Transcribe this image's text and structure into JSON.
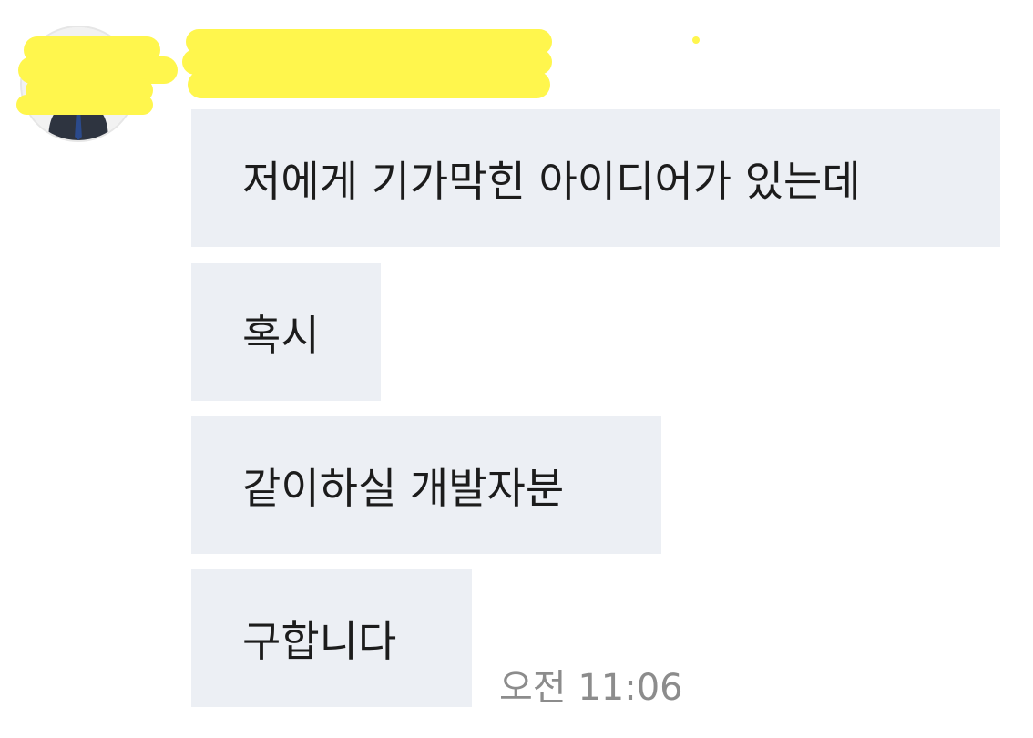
{
  "sender": {
    "avatar_icon": "profile-photo-person-in-suit",
    "name_redacted": true,
    "redaction_color": "#fff64d"
  },
  "messages": [
    {
      "text": "저에게 기가막힌 아이디어가 있는데"
    },
    {
      "text": "혹시"
    },
    {
      "text": "같이하실 개발자분"
    },
    {
      "text": "구합니다"
    }
  ],
  "timestamp": "오전 11:06",
  "colors": {
    "bubble_background": "#eceff4",
    "message_text": "#1c1c1c",
    "timestamp_text": "#8c8c8c"
  }
}
